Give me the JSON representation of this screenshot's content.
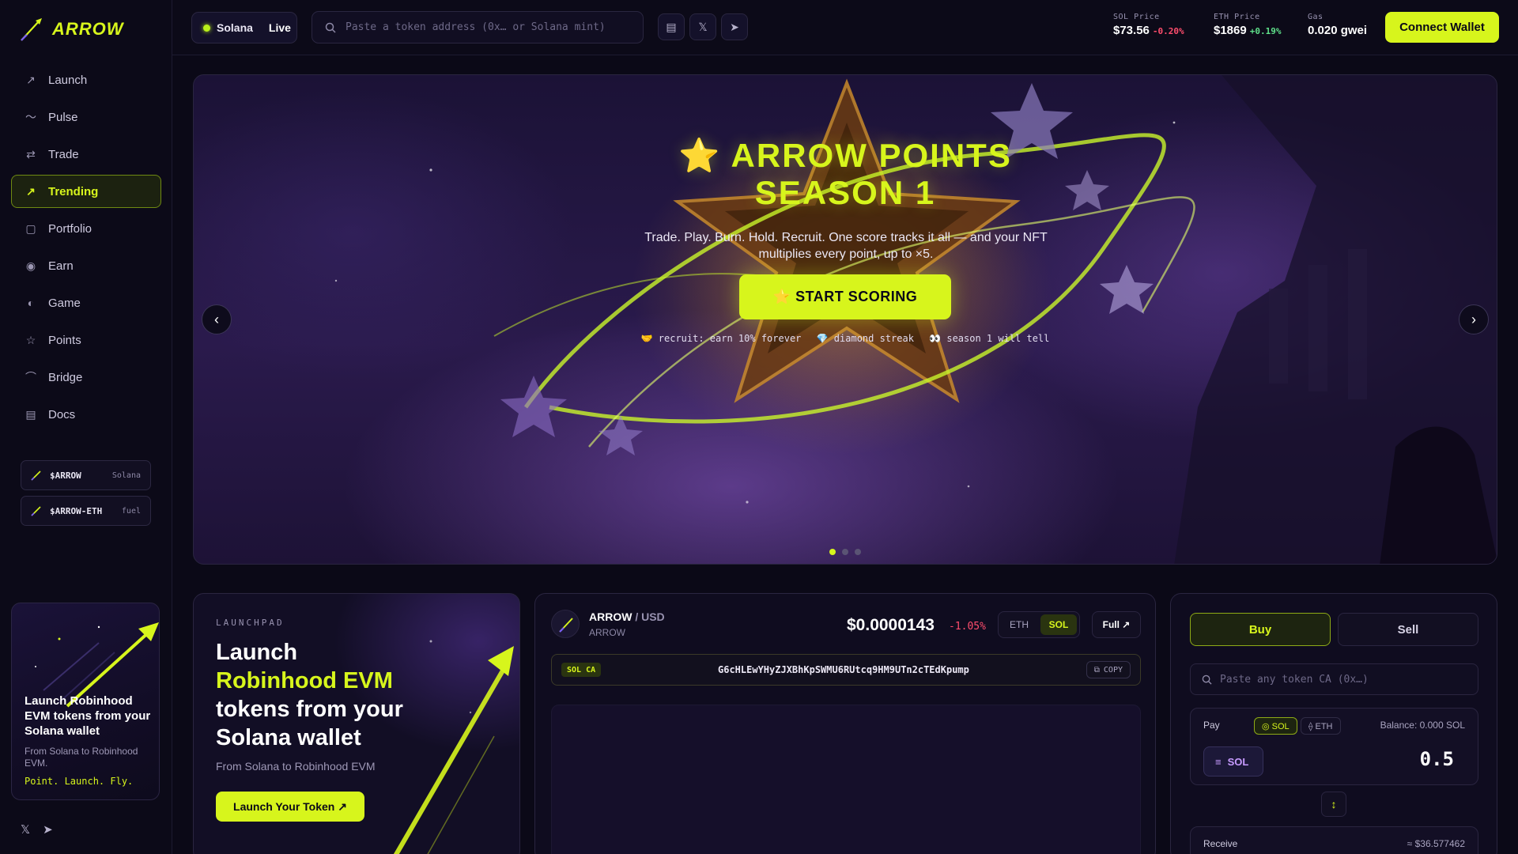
{
  "brand": {
    "name": "ARROW"
  },
  "sidebar": {
    "items": [
      {
        "label": "Launch",
        "icon": "arrow-up-right-icon",
        "glyph": "↗"
      },
      {
        "label": "Pulse",
        "icon": "pulse-icon",
        "glyph": "〜"
      },
      {
        "label": "Trade",
        "icon": "swap-icon",
        "glyph": "⇄"
      },
      {
        "label": "Trending",
        "icon": "trending-icon",
        "glyph": "↗",
        "active": true
      },
      {
        "label": "Portfolio",
        "icon": "briefcase-icon",
        "glyph": "▢"
      },
      {
        "label": "Earn",
        "icon": "coin-icon",
        "glyph": "◉"
      },
      {
        "label": "Game",
        "icon": "gamepad-icon",
        "glyph": "◐"
      },
      {
        "label": "Points",
        "icon": "star-icon",
        "glyph": "☆"
      },
      {
        "label": "Bridge",
        "icon": "bridge-icon",
        "glyph": "⌒"
      },
      {
        "label": "Docs",
        "icon": "document-icon",
        "glyph": "▤"
      }
    ],
    "tokens": [
      {
        "name": "$ARROW",
        "network": "Solana"
      },
      {
        "name": "$ARROW-ETH",
        "network": "fuel"
      }
    ],
    "promo": {
      "title": "Launch Robinhood EVM tokens from your Solana wallet",
      "subtitle": "From Solana to Robinhood EVM.",
      "tagline": "Point. Launch. Fly."
    }
  },
  "topbar": {
    "network": "Solana",
    "status": "Live",
    "search_placeholder": "Paste a token address (0x… or Solana mint)",
    "stats": [
      {
        "label": "SOL Price",
        "value": "$73.56",
        "change": "-0.20%",
        "dir": "neg"
      },
      {
        "label": "ETH Price",
        "value": "$1869",
        "change": "+0.19%",
        "dir": "pos"
      },
      {
        "label": "Gas",
        "value": "0.020 gwei",
        "change": "",
        "dir": ""
      }
    ],
    "connect_label": "Connect Wallet"
  },
  "hero": {
    "title_line1": "⭐ ARROW POINTS",
    "title_line2": "SEASON 1",
    "subtitle": "Trade. Play. Burn. Hold. Recruit. One score tracks it all — and your NFT multiplies every point, up to ×5.",
    "cta_label": "⭐ START SCORING",
    "tags": [
      "🤝 recruit: earn 10% forever",
      "💎 diamond streak",
      "👀 season 1 will tell"
    ],
    "prev": "‹",
    "next": "›",
    "slide_count": 3,
    "active_slide": 1
  },
  "launchpad": {
    "kicker": "LAUNCHPAD",
    "heading_line1": "Launch",
    "heading_highlight": "Robinhood EVM",
    "heading_line3": "tokens from your Solana wallet",
    "subtitle": "From Solana to Robinhood EVM",
    "button_label": "Launch Your Token ↗"
  },
  "market": {
    "pair_base": "ARROW",
    "pair_quote": "/ USD",
    "pair_sub": "ARROW",
    "price": "$0.0000143",
    "change": "-1.05%",
    "networks": [
      "ETH",
      "SOL"
    ],
    "active_network": "SOL",
    "full_label": "Full ↗",
    "ca_badge": "SOL CA",
    "ca_address": "G6cHLEwYHyZJXBhKpSWMU6RUtcq9HM9UTn2cTEdKpump",
    "copy_label": "COPY"
  },
  "swap": {
    "buy_label": "Buy",
    "sell_label": "Sell",
    "ca_placeholder": "Paste any token CA (0x…)",
    "pay_label": "Pay",
    "pay_options": [
      "◎ SOL",
      "⟠ ETH"
    ],
    "balance": "Balance: 0.000 SOL",
    "coin": "SOL",
    "amount": "0.5",
    "swap_glyph": "↕",
    "receive_label": "Receive",
    "receive_value": "≈ $36.577462"
  },
  "colors": {
    "accent": "#d7f51c",
    "negative": "#ff4d6d",
    "positive": "#5fe08a",
    "background": "#0b0917"
  }
}
